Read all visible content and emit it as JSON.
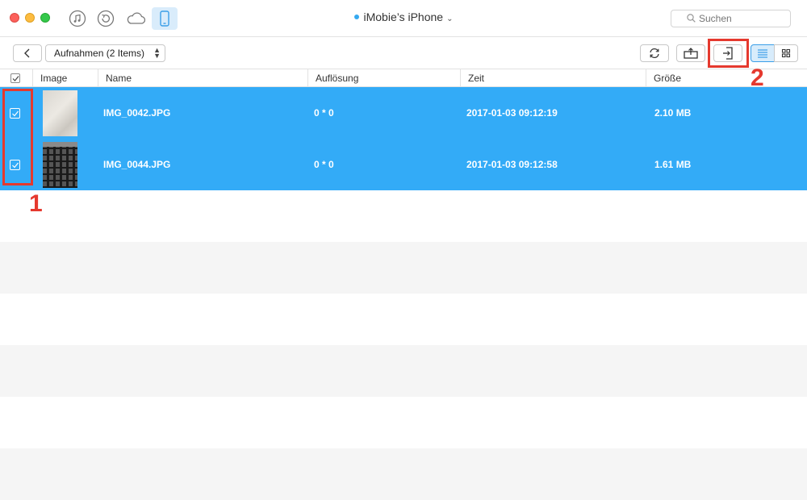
{
  "window": {
    "device_name": "iMobie’s iPhone",
    "device_chevron": "⌄",
    "search_placeholder": "Suchen"
  },
  "title_icons": [
    "music-icon",
    "restore-icon",
    "cloud-icon",
    "phone-icon"
  ],
  "toolbar": {
    "back_icon": "chevron-left-icon",
    "album_label": "Aufnahmen (2 Items)",
    "refresh_icon": "refresh-icon",
    "export_icon": "export-to-computer-icon",
    "to_device_icon": "send-to-device-icon",
    "list_view_icon": "list-view-icon",
    "grid_view_icon": "grid-view-icon",
    "active_view": "list"
  },
  "table": {
    "columns": [
      "Image",
      "Name",
      "Auflösung",
      "Zeit",
      "Größe"
    ],
    "rows": [
      {
        "name": "IMG_0042.JPG",
        "resolution": "0 * 0",
        "time": "2017-01-03 09:12:19",
        "size": "2.10 MB",
        "checked": true,
        "selected": true
      },
      {
        "name": "IMG_0044.JPG",
        "resolution": "0 * 0",
        "time": "2017-01-03 09:12:58",
        "size": "1.61 MB",
        "checked": true,
        "selected": true
      }
    ]
  },
  "annotations": {
    "label_1": "1",
    "label_2": "2"
  },
  "colors": {
    "selection": "#33abf7",
    "annotation": "#e5392e",
    "accent": "#35a9f0"
  }
}
